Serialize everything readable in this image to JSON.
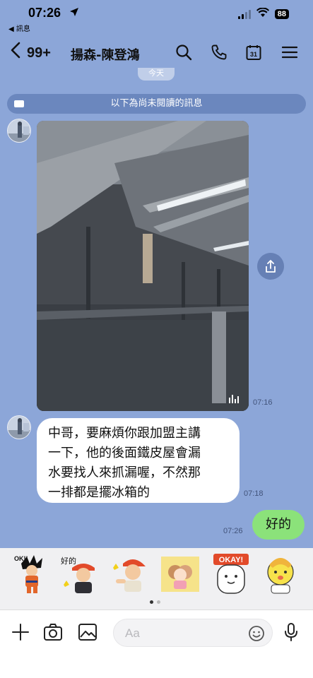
{
  "status": {
    "time": "07:26",
    "back_label": "◀ 訊息",
    "battery": "88"
  },
  "header": {
    "unread_count": "99+",
    "title": "揚森-陳登鴻"
  },
  "chat": {
    "date_pill": "今天",
    "unread_banner": "以下為尚未閱讀的訊息",
    "photo_time": "07:16",
    "message_in": {
      "lines": [
        "中哥，要麻煩你跟加盟主講",
        "一下，他的後面鐵皮屋會漏",
        "水要找人來抓漏喔，不然那",
        "一排都是擺冰箱的"
      ],
      "time": "07:18"
    },
    "message_out": {
      "text": "好的",
      "time": "07:26"
    }
  },
  "stickers": {
    "labels": [
      "OK!!",
      "好的",
      "OKAY!"
    ],
    "page_count": 2,
    "active_page": 1
  },
  "input": {
    "placeholder": "Aa"
  },
  "colors": {
    "chat_bg": "#8ca6d8",
    "outgoing_bubble": "#8be27a",
    "incoming_bubble": "#ffffff"
  }
}
